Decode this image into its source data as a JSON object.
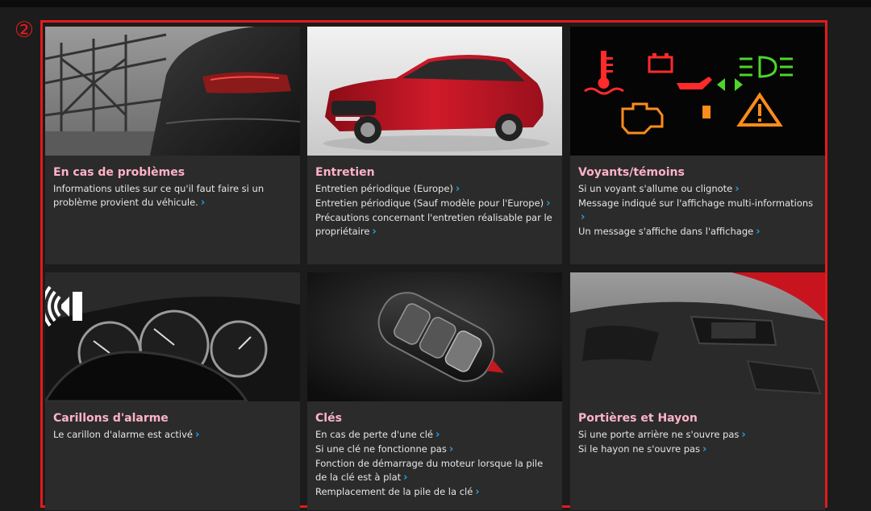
{
  "badge": {
    "number": "②"
  },
  "colors": {
    "frame": "#e21b1b",
    "title": "#ffb3c8",
    "link_text": "#e6e6e6",
    "chevron": "#2a9be0",
    "card_bg": "#2b2b2b"
  },
  "chevron_glyph": "›",
  "cards": [
    {
      "title": "En cas de problèmes",
      "image_icon": "car-rear-photo",
      "links": [
        "Informations utiles sur ce qu'il faut faire si un problème provient du véhicule."
      ]
    },
    {
      "title": "Entretien",
      "image_icon": "red-sedan-photo",
      "links": [
        "Entretien périodique (Europe)",
        "Entretien périodique (Sauf modèle pour l'Europe)",
        "Précautions concernant l'entretien réalisable par le propriétaire"
      ]
    },
    {
      "title": "Voyants/témoins",
      "image_icon": "warning-lights-photo",
      "links": [
        "Si un voyant s'allume ou clignote",
        "Message indiqué sur l'affichage multi-informations",
        "Un message s'affiche dans l'affichage"
      ]
    },
    {
      "title": "Carillons d'alarme",
      "image_icon": "dashboard-speaker-photo",
      "links": [
        "Le carillon d'alarme est activé"
      ]
    },
    {
      "title": "Clés",
      "image_icon": "smart-key-photo",
      "links": [
        "En cas de perte d'une clé",
        "Si une clé ne fonctionne pas",
        "Fonction de démarrage du moteur lorsque la pile de la clé est à plat",
        "Remplacement de la pile de la clé"
      ]
    },
    {
      "title": "Portières et Hayon",
      "image_icon": "dashboard-interior-photo",
      "links": [
        "Si une porte arrière ne s'ouvre pas",
        "Si le hayon ne s'ouvre pas"
      ]
    }
  ]
}
